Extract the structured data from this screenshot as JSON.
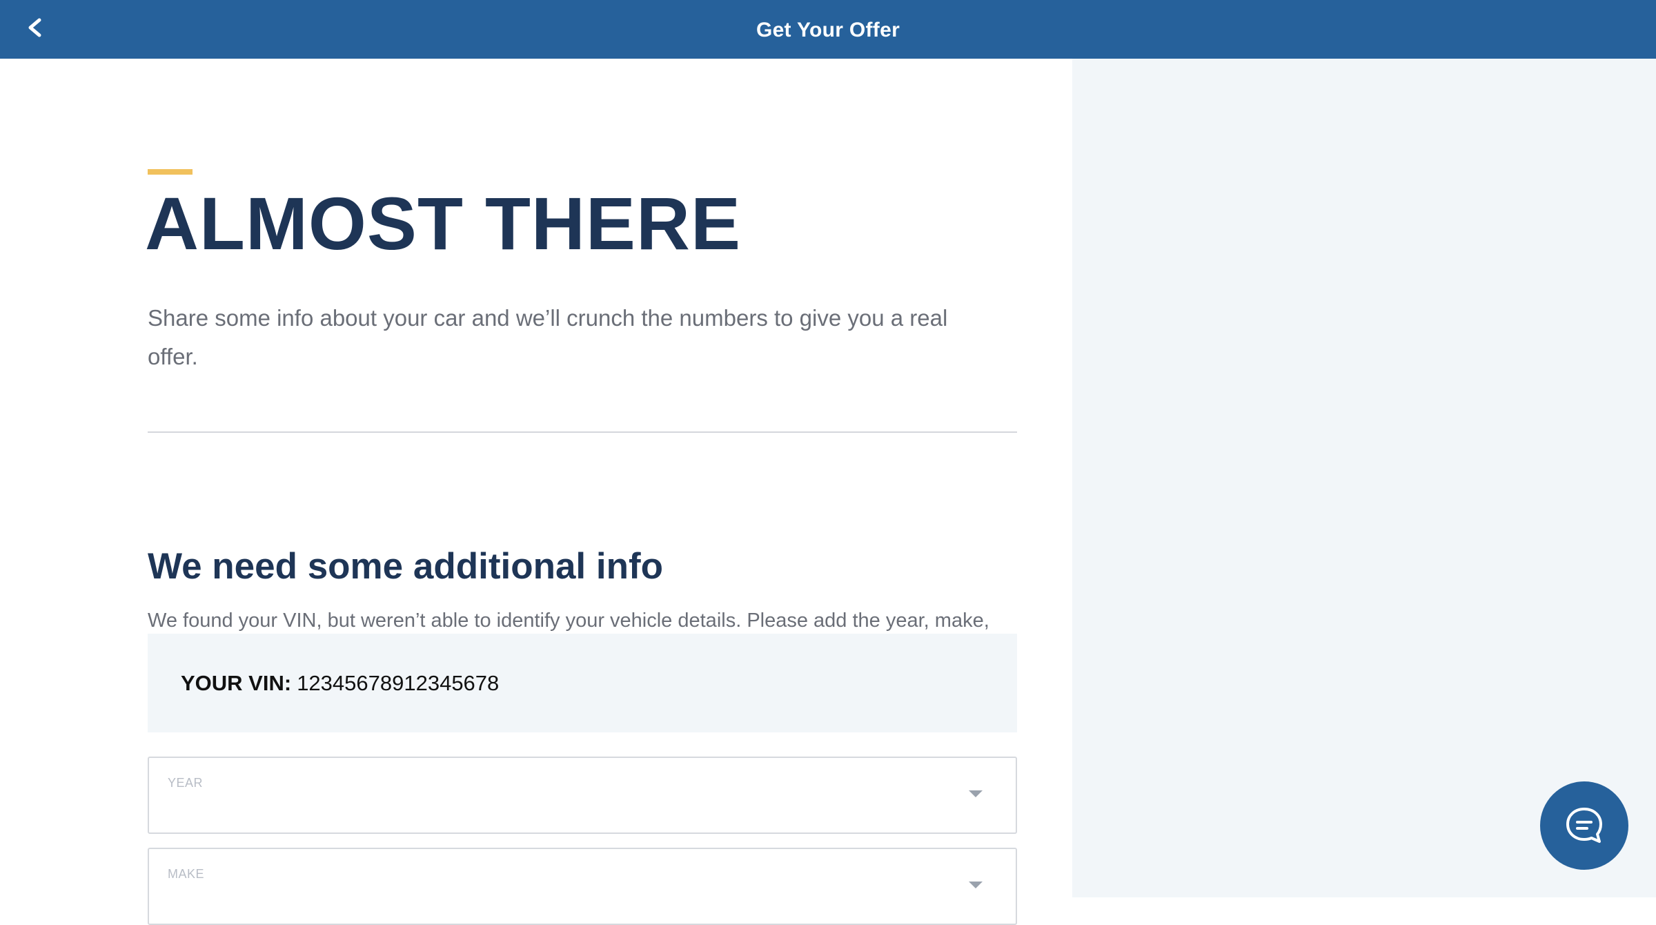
{
  "header": {
    "title": "Get Your Offer"
  },
  "hero": {
    "heading": "ALMOST THERE",
    "intro": "Share some info about your car and we’ll crunch the numbers to give you a real offer."
  },
  "details": {
    "heading": "We need some additional info",
    "description": "We found your VIN, but weren’t able to identify your vehicle details. Please add the year, make, model, and trim below."
  },
  "vin": {
    "label": "YOUR VIN:",
    "value": "12345678912345678"
  },
  "fields": {
    "year_label": "YEAR",
    "make_label": "MAKE"
  },
  "icons": {
    "back": "chevron-left-icon",
    "dropdown": "caret-down-icon",
    "chat": "chat-bubble-icon"
  },
  "colors": {
    "header_bg": "#26619b",
    "accent": "#f1c15d",
    "heading": "#1e3556",
    "panel_bg": "#f2f6f9"
  }
}
